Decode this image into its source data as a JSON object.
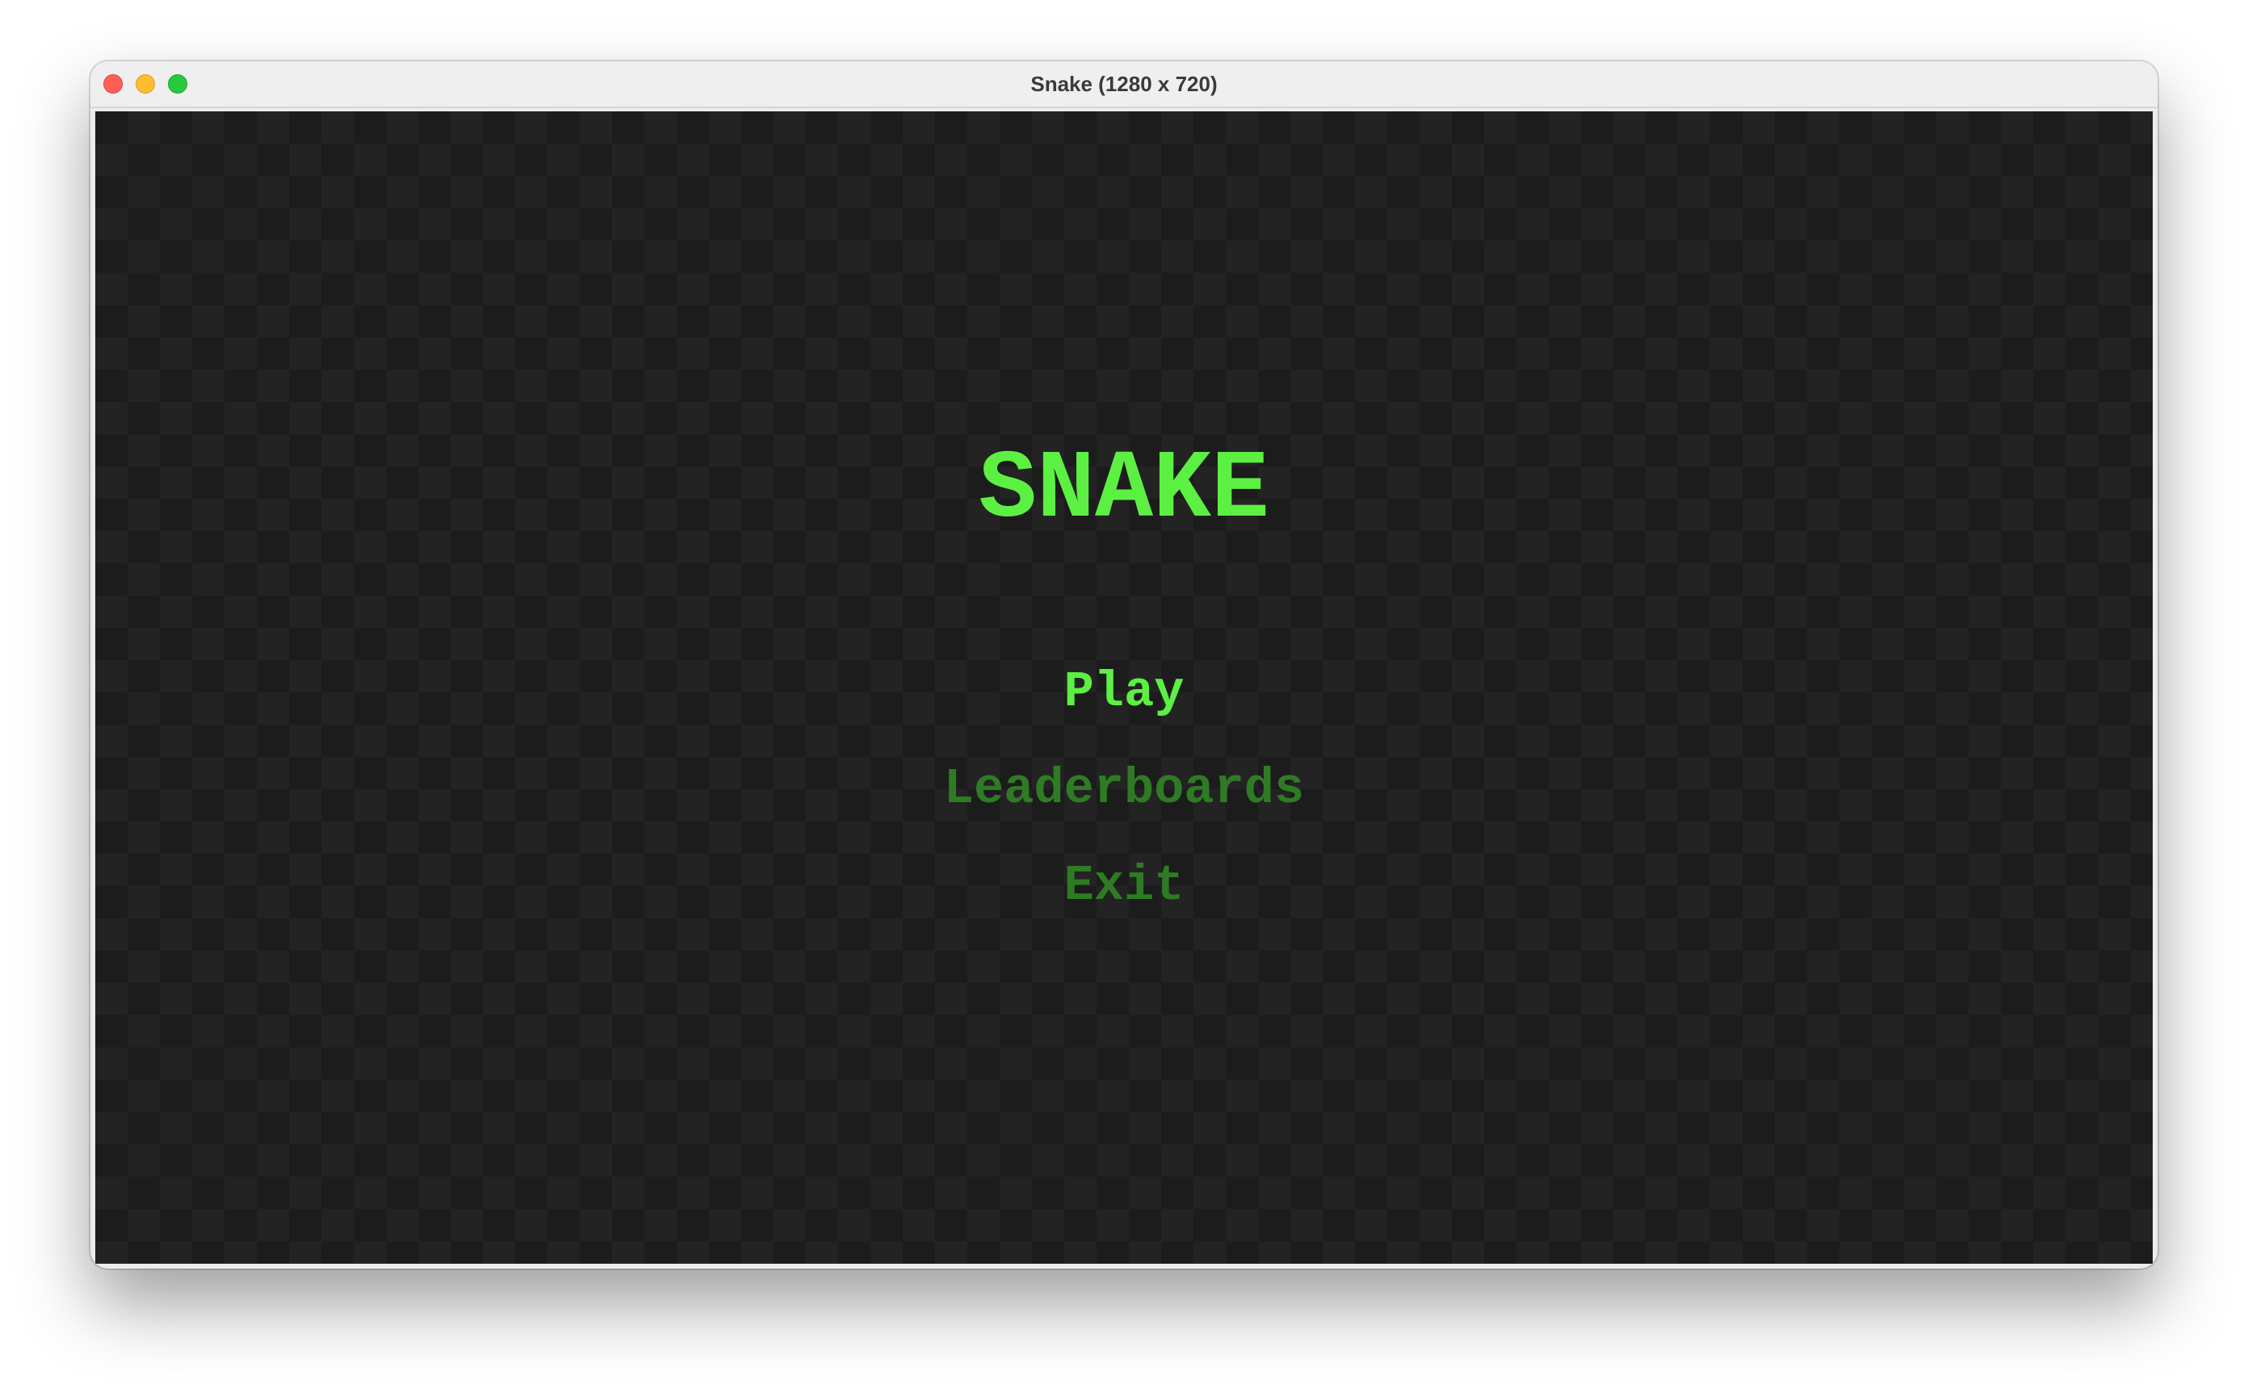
{
  "window": {
    "title": "Snake (1280 x 720)"
  },
  "game": {
    "title": "SNAKE",
    "menu": [
      {
        "label": "Play",
        "selected": true
      },
      {
        "label": "Leaderboards",
        "selected": false
      },
      {
        "label": "Exit",
        "selected": false
      }
    ]
  },
  "colors": {
    "accent": "#5cf043",
    "accent_dim": "#2e7b24",
    "background": "#1c1c1c",
    "checker": "#232323"
  }
}
